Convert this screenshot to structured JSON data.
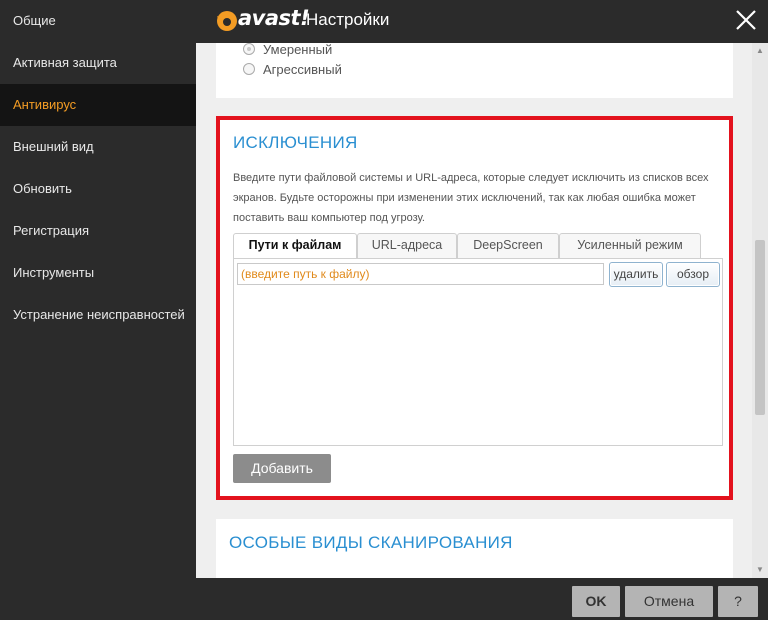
{
  "app": {
    "logo_text": "avast!",
    "title": "Настройки",
    "brand_color": "#f39c24"
  },
  "sidebar": {
    "items": [
      {
        "label": "Общие"
      },
      {
        "label": "Активная защита"
      },
      {
        "label": "Антивирус",
        "active": true
      },
      {
        "label": "Внешний вид"
      },
      {
        "label": "Обновить"
      },
      {
        "label": "Регистрация"
      },
      {
        "label": "Инструменты"
      },
      {
        "label": "Устранение неисправностей"
      }
    ]
  },
  "sensitivity": {
    "options": [
      {
        "label": "Умеренный",
        "checked": true
      },
      {
        "label": "Агрессивный",
        "checked": false
      }
    ]
  },
  "exclusions": {
    "title": "ИСКЛЮЧЕНИЯ",
    "description": "Введите пути файловой системы и URL-адреса, которые следует исключить из списков всех экранов. Будьте осторожны при изменении этих исключений, так как любая ошибка может поставить ваш компьютер под угрозу.",
    "tabs": [
      {
        "label": "Пути к файлам",
        "active": true
      },
      {
        "label": "URL-адреса"
      },
      {
        "label": "DeepScreen"
      },
      {
        "label": "Усиленный режим"
      }
    ],
    "path_placeholder": "(введите путь к файлу)",
    "delete_label": "удалить",
    "browse_label": "обзор",
    "add_label": "Добавить",
    "highlight_color": "#e3121d"
  },
  "special_scans": {
    "title": "ОСОБЫЕ ВИДЫ СКАНИРОВАНИЯ"
  },
  "footer": {
    "ok_label": "OK",
    "cancel_label": "Отмена",
    "help_label": "?"
  }
}
